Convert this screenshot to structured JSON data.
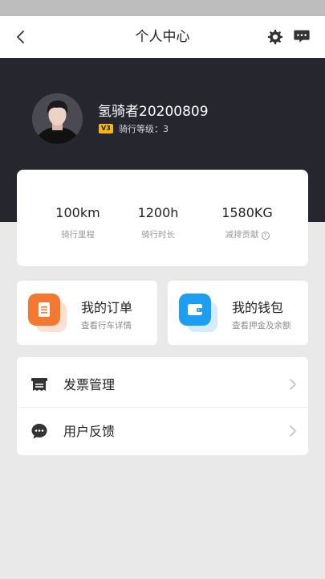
{
  "header": {
    "title": "个人中心",
    "back_icon": "chevron-left-icon",
    "settings_icon": "gear-icon",
    "message_icon": "message-icon"
  },
  "profile": {
    "username": "氢骑者20200809",
    "level_badge": "V3",
    "level_text": "骑行等级：3",
    "avatar_icon": "avatar"
  },
  "stats": [
    {
      "value": "100km",
      "label": "骑行里程"
    },
    {
      "value": "1200h",
      "label": "骑行时长"
    },
    {
      "value": "1580KG",
      "label": "减排贡献"
    }
  ],
  "actions": [
    {
      "title": "我的订单",
      "subtitle": "查看行车详情",
      "icon": "order-icon",
      "color": "#f2792f"
    },
    {
      "title": "我的钱包",
      "subtitle": "查看押金及余额",
      "icon": "wallet-icon",
      "color": "#1e9ef0"
    }
  ],
  "menu": [
    {
      "label": "发票管理",
      "icon": "invoice-icon"
    },
    {
      "label": "用户反馈",
      "icon": "feedback-icon"
    }
  ],
  "colors": {
    "header_dark": "#26262e",
    "level_badge": "#f5b90f",
    "order_accent": "#f2792f",
    "wallet_accent": "#1e9ef0"
  }
}
